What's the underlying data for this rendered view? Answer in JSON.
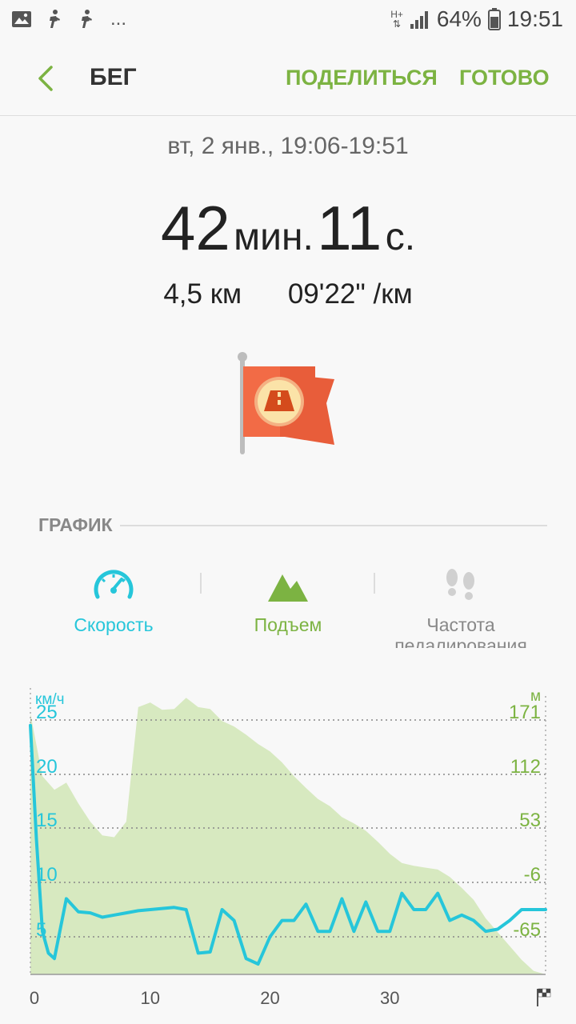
{
  "status_bar": {
    "battery_percent": "64%",
    "time": "19:51",
    "network_type": "H+",
    "notification_icons": [
      "image-icon",
      "running-person-icon",
      "running-person-icon"
    ],
    "more": "..."
  },
  "app_bar": {
    "title": "БЕГ",
    "share_label": "ПОДЕЛИТЬСЯ",
    "done_label": "ГОТОВО"
  },
  "summary": {
    "date": "вт, 2 янв., 19:06-19:51",
    "minutes_value": "42",
    "minutes_unit": "мин.",
    "seconds_value": "11",
    "seconds_unit": "с.",
    "distance": "4,5 км",
    "pace": "09'22\" /км",
    "badge_icon": "road-flag-icon"
  },
  "graph_section": {
    "title": "ГРАФИК",
    "tabs": [
      {
        "label": "Скорость",
        "icon": "speedometer-icon",
        "color": "#26c6da"
      },
      {
        "label": "Подъем",
        "icon": "mountain-icon",
        "color": "#7cb342"
      },
      {
        "label": "Частота педалирования",
        "icon": "footprints-icon",
        "color": "#888888"
      }
    ]
  },
  "chart_data": {
    "type": "area",
    "left_axis": {
      "label": "км/ч",
      "ticks": [
        "25",
        "20",
        "15",
        "10",
        "5"
      ],
      "color": "#26c6da"
    },
    "right_axis": {
      "label": "м",
      "ticks": [
        "171",
        "112",
        "53",
        "-6",
        "-65"
      ],
      "color": "#7cb342"
    },
    "x_ticks": [
      "0",
      "10",
      "20",
      "30"
    ],
    "xlim": [
      0,
      43
    ],
    "series": [
      {
        "kind": "area",
        "color": "#d7e9c0",
        "x": [
          0,
          1,
          2,
          3,
          4,
          5,
          6,
          7,
          8,
          9,
          10,
          11,
          12,
          13,
          14,
          15,
          16,
          17,
          18,
          19,
          20,
          21,
          22,
          23,
          24,
          25,
          26,
          27,
          28,
          29,
          30,
          31,
          32,
          33,
          34,
          35,
          36,
          37,
          38,
          39,
          40,
          41,
          42,
          43
        ],
        "values": [
          178,
          110,
          95,
          103,
          80,
          60,
          45,
          43,
          60,
          185,
          190,
          182,
          183,
          195,
          185,
          183,
          170,
          164,
          155,
          145,
          137,
          125,
          110,
          97,
          85,
          77,
          65,
          58,
          50,
          38,
          25,
          15,
          12,
          10,
          8,
          0,
          -12,
          -25,
          -45,
          -60,
          -75,
          -90,
          -102,
          -113
        ]
      },
      {
        "kind": "line",
        "color": "#26c6da",
        "x": [
          0,
          0.5,
          1,
          1.5,
          2,
          3,
          4,
          5,
          6,
          7,
          8,
          9,
          10,
          11,
          12,
          13,
          14,
          15,
          16,
          17,
          18,
          19,
          20,
          21,
          22,
          23,
          24,
          25,
          26,
          27,
          28,
          29,
          30,
          31,
          32,
          33,
          34,
          35,
          36,
          37,
          38,
          39,
          40,
          41,
          42,
          43
        ],
        "values": [
          24.5,
          14,
          5.5,
          3.5,
          3,
          8.5,
          7.3,
          7.2,
          6.8,
          7.0,
          7.2,
          7.4,
          7.5,
          7.6,
          7.7,
          7.5,
          3.5,
          3.6,
          7.5,
          6.5,
          3,
          2.5,
          5,
          6.5,
          6.5,
          8,
          5.5,
          5.5,
          8.5,
          5.5,
          8.2,
          5.5,
          5.5,
          9,
          7.5,
          7.5,
          9,
          6.5,
          7,
          6.5,
          5.5,
          5.7,
          6.5,
          7.5,
          7.5,
          7.5
        ]
      }
    ],
    "grid": "dotted"
  }
}
